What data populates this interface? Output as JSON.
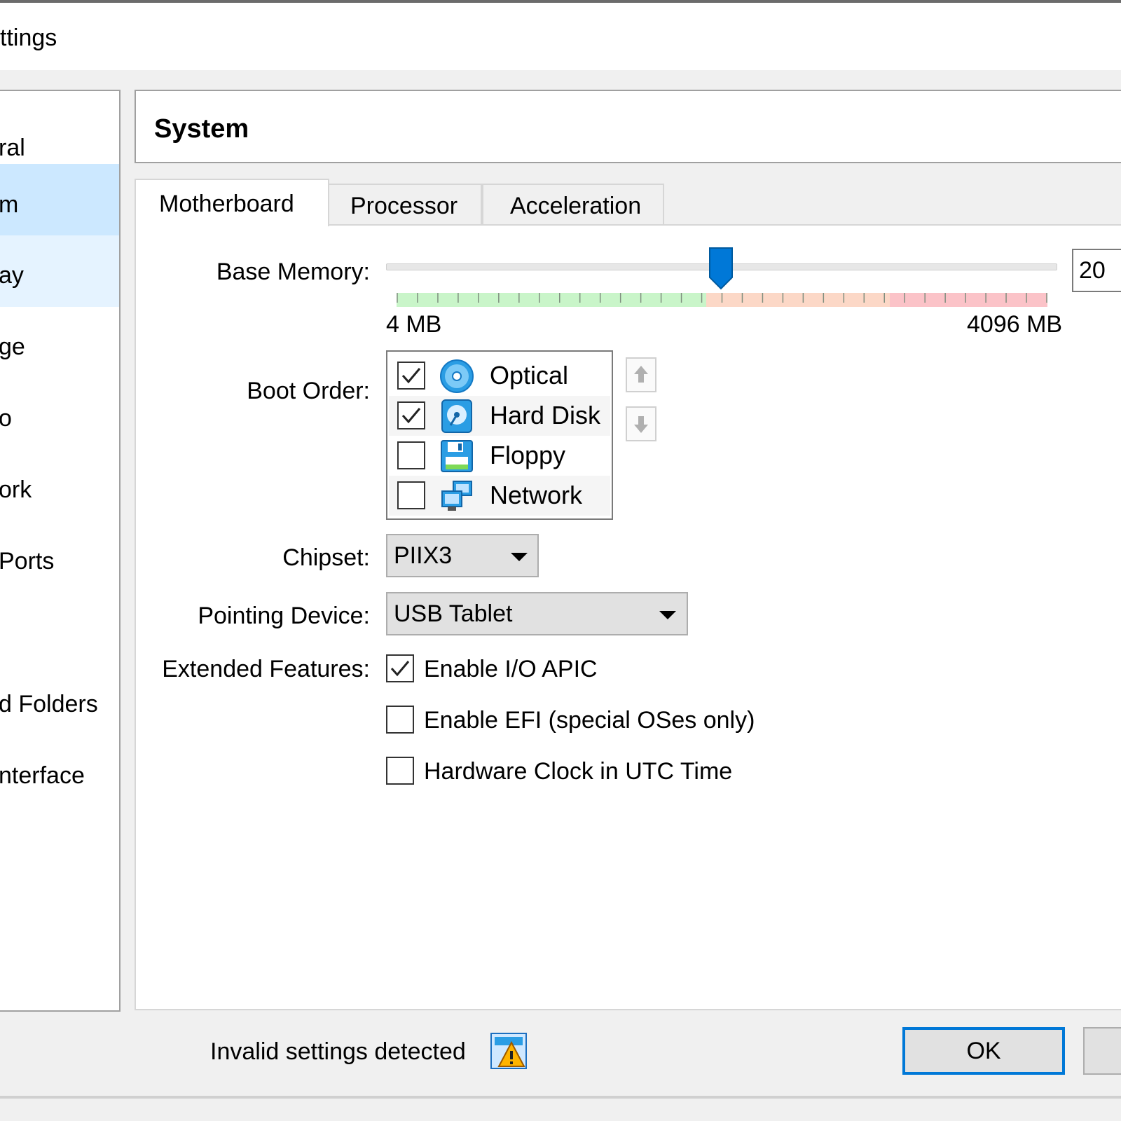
{
  "window": {
    "title": "ttings"
  },
  "sidebar": {
    "items": [
      {
        "label": "ral"
      },
      {
        "label": "m"
      },
      {
        "label": "ay"
      },
      {
        "label": "ge"
      },
      {
        "label": "o"
      },
      {
        "label": "ork"
      },
      {
        "label": " Ports"
      },
      {
        "label": ""
      },
      {
        "label": "d Folders"
      },
      {
        "label": "nterface"
      }
    ],
    "selected_index": 1
  },
  "page": {
    "title": "System"
  },
  "tabs": [
    {
      "label": "Motherboard",
      "active": true
    },
    {
      "label": "Processor",
      "active": false
    },
    {
      "label": "Acceleration",
      "active": false
    }
  ],
  "base_memory": {
    "label": "Base Memory:",
    "min_label": "4 MB",
    "max_label": "4096 MB",
    "value_text": "20",
    "slider_fraction": 0.5
  },
  "boot_order": {
    "label": "Boot Order:",
    "devices": [
      {
        "name": "Optical",
        "checked": true,
        "icon": "optical-disc-icon"
      },
      {
        "name": "Hard Disk",
        "checked": true,
        "icon": "hard-disk-icon"
      },
      {
        "name": "Floppy",
        "checked": false,
        "icon": "floppy-icon"
      },
      {
        "name": "Network",
        "checked": false,
        "icon": "network-icon"
      }
    ]
  },
  "chipset": {
    "label": "Chipset:",
    "value": "PIIX3"
  },
  "pointing_device": {
    "label": "Pointing Device:",
    "value": "USB Tablet"
  },
  "extended_features": {
    "label": "Extended Features:",
    "options": [
      {
        "label": "Enable I/O APIC",
        "checked": true
      },
      {
        "label": "Enable EFI (special OSes only)",
        "checked": false
      },
      {
        "label": "Hardware Clock in UTC Time",
        "checked": false
      }
    ]
  },
  "footer": {
    "status_text": "Invalid settings detected",
    "ok_label": "OK"
  },
  "colors": {
    "selection": "#cce8ff",
    "accent": "#0078d7",
    "scale_green": "#c9f5c9",
    "scale_orange": "#fcd8c7",
    "scale_red": "#fbc3c8"
  }
}
